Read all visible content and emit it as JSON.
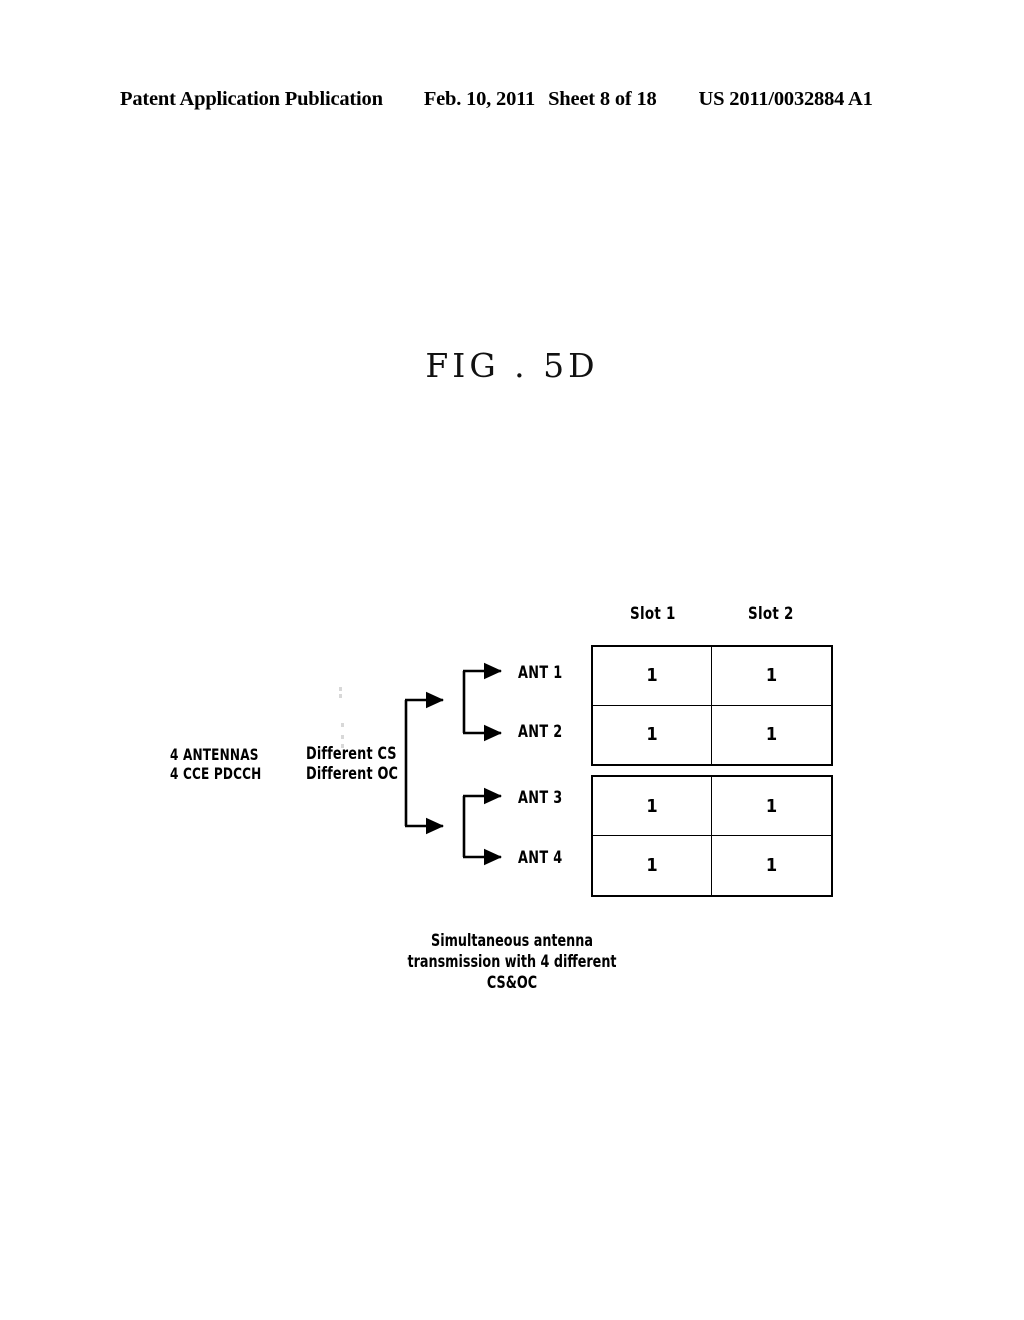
{
  "header": {
    "publication": "Patent Application Publication",
    "date": "Feb. 10, 2011",
    "sheet": "Sheet 8 of 18",
    "pub_number": "US 2011/0032884 A1"
  },
  "figure": {
    "title": "FIG . 5D",
    "source_label": "4 ANTENNAS\n4 CCE PDCCH",
    "source_label_line1": "4 ANTENNAS",
    "source_label_line2": "4 CCE PDCCH",
    "branch_label_line1": "Different CS",
    "branch_label_line2": "Different OC",
    "antennas": [
      {
        "label": "ANT 1"
      },
      {
        "label": "ANT 2"
      },
      {
        "label": "ANT 3"
      },
      {
        "label": "ANT 4"
      }
    ],
    "caption_line1": "Simultaneous antenna",
    "caption_line2": "transmission with 4 different",
    "caption_line3": "CS&OC",
    "colors": {
      "ink": "#000000",
      "page": "#ffffff"
    }
  },
  "chart_data": {
    "type": "table",
    "title": "FIG . 5D",
    "columns": [
      "Slot 1",
      "Slot 2"
    ],
    "row_labels": [
      "ANT 1",
      "ANT 2",
      "ANT 3",
      "ANT 4"
    ],
    "tables": [
      {
        "name": "upper-block",
        "rows": [
          {
            "label": "ANT 1",
            "cells": [
              "1",
              "1"
            ]
          },
          {
            "label": "ANT 2",
            "cells": [
              "1",
              "1"
            ]
          }
        ]
      },
      {
        "name": "lower-block",
        "rows": [
          {
            "label": "ANT 3",
            "cells": [
              "1",
              "1"
            ]
          },
          {
            "label": "ANT 4",
            "cells": [
              "1",
              "1"
            ]
          }
        ]
      }
    ],
    "values": [
      [
        1,
        1
      ],
      [
        1,
        1
      ],
      [
        1,
        1
      ],
      [
        1,
        1
      ]
    ],
    "annotations": [
      "4 ANTENNAS",
      "4 CCE PDCCH",
      "Different CS",
      "Different OC",
      "Simultaneous antenna transmission with 4 different CS&OC"
    ],
    "xlabel": "",
    "ylabel": "",
    "grid": true,
    "legend": "none"
  }
}
